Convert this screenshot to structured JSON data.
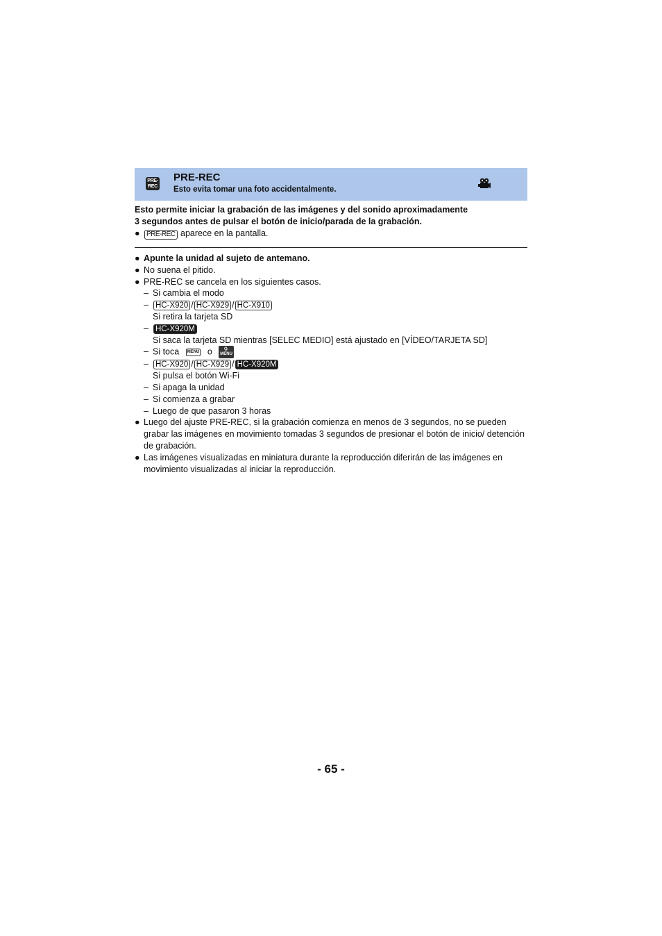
{
  "header": {
    "icon_text_top": "PRE-",
    "icon_text_bottom": "REC",
    "title": "PRE-REC",
    "subtitle": "Esto evita tomar una foto accidentalmente.",
    "mode_icon": "video-camera-icon",
    "background_color": "#adc6ea"
  },
  "intro": {
    "line1": "Esto permite iniciar la grabación de las imágenes y del sonido aproximadamente",
    "line2": "3  segundos antes de pulsar el botón de inicio/parada de la grabación.",
    "bullet_tag": "PRE-REC",
    "bullet_text": "aparece en la pantalla."
  },
  "notes": {
    "item1": "Apunte la unidad al sujeto de antemano.",
    "item2": "No suena el pitido.",
    "item3": "PRE-REC se cancela en los siguientes casos.",
    "cases": {
      "c1": "Si cambia el modo",
      "c2_tags": [
        "HC-X920",
        "HC-X929",
        "HC-X910"
      ],
      "c2_text": "Si retira la tarjeta SD",
      "c3_tag": "HC-X920M",
      "c3_text": "Si saca la tarjeta SD mientras [SELEC MEDIO] está ajustado en [VÍDEO/TARJETA SD]",
      "c4_prefix": "Si toca",
      "c4_menu_icon": "MENU",
      "c4_or": "o",
      "c4_qmenu_top": "Q.",
      "c4_qmenu_bottom": "MENU",
      "c5_tags": [
        "HC-X920",
        "HC-X929",
        "HC-X920M"
      ],
      "c5_text": "Si pulsa el botón Wi-Fi",
      "c6": "Si apaga la unidad",
      "c7": "Si comienza a grabar",
      "c8": "Luego de que pasaron 3 horas"
    },
    "item4": "Luego del ajuste PRE-REC, si la grabación comienza en menos de 3 segundos, no se pueden grabar las imágenes en movimiento tomadas 3 segundos de presionar el botón de inicio/ detención de grabación.",
    "item5": "Las imágenes visualizadas en miniatura durante la reproducción diferirán de las imágenes en movimiento visualizadas al iniciar la reproducción.",
    "bullet": "●",
    "dash": "–",
    "sep": "/"
  },
  "page_number": "- 65 -"
}
